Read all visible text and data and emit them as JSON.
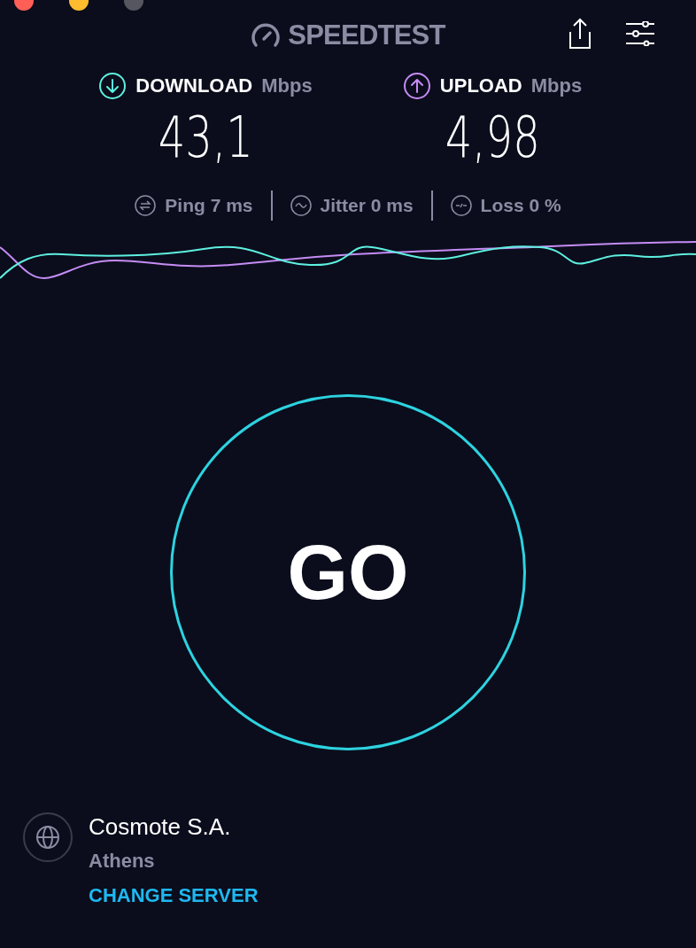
{
  "header": {
    "title": "SPEEDTEST"
  },
  "results": [
    {
      "kind": "download",
      "label": "DOWNLOAD",
      "unit": "Mbps",
      "value": "43,1"
    },
    {
      "kind": "upload",
      "label": "UPLOAD",
      "unit": "Mbps",
      "value": "4,98"
    }
  ],
  "metrics": [
    {
      "kind": "ping",
      "text": "Ping 7 ms"
    },
    {
      "kind": "jitter",
      "text": "Jitter 0 ms"
    },
    {
      "kind": "loss",
      "text": "Loss 0 %"
    }
  ],
  "go_button": {
    "label": "GO"
  },
  "server": {
    "provider": "Cosmote S.A.",
    "location": "Athens",
    "action": "CHANGE SERVER"
  }
}
